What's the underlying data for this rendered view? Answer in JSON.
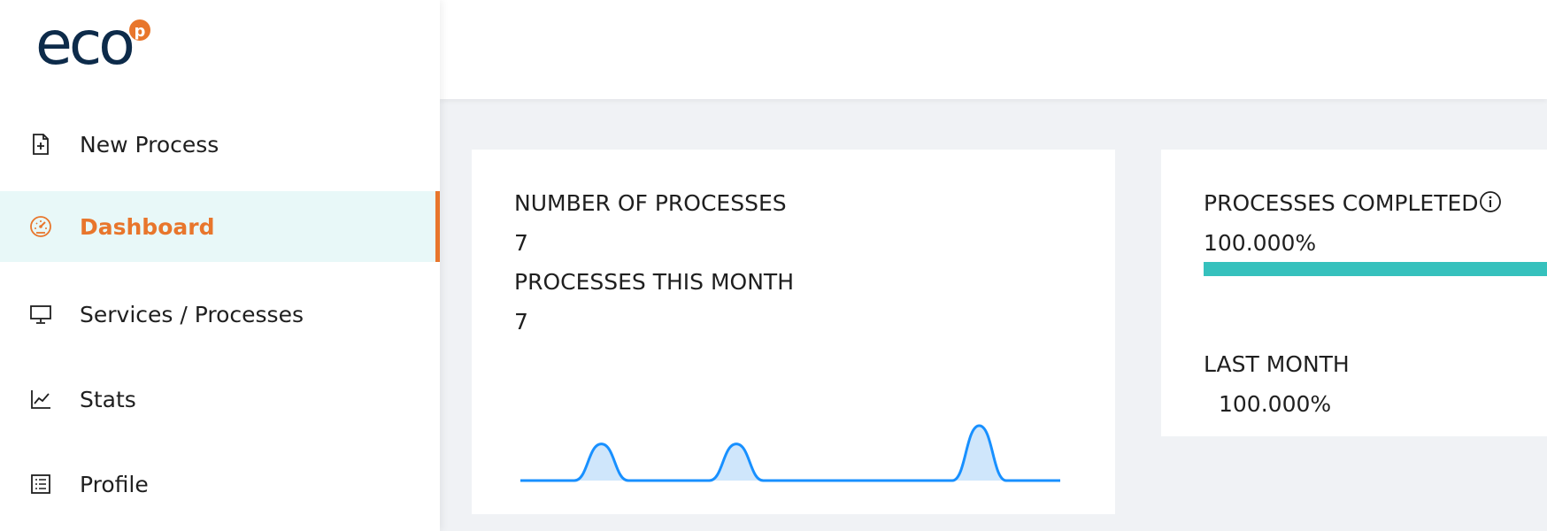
{
  "sidebar": {
    "logo_text": "eco",
    "logo_badge": "p",
    "items": [
      {
        "label": "New Process",
        "icon": "file-plus-icon",
        "active": false
      },
      {
        "label": "Dashboard",
        "icon": "speedometer-icon",
        "active": true
      },
      {
        "label": "Services / Processes",
        "icon": "monitor-icon",
        "active": false
      },
      {
        "label": "Stats",
        "icon": "line-chart-icon",
        "active": false
      },
      {
        "label": "Profile",
        "icon": "profile-list-icon",
        "active": false
      }
    ]
  },
  "colors": {
    "accent": "#e8762c",
    "active_bg": "#e8f8f8",
    "progress": "#36c1bd",
    "sparkline": "#1890ff",
    "logo_navy": "#0d2b4a"
  },
  "stats_card": {
    "number_label": "NUMBER OF PROCESSES",
    "number_value": "7",
    "month_label": "PROCESSES THIS MONTH",
    "month_value": "7"
  },
  "chart_data": {
    "type": "area",
    "x": [
      0,
      1,
      2,
      3,
      4,
      5,
      6,
      7,
      8,
      9,
      10,
      11,
      12,
      13,
      14,
      15,
      16,
      17,
      18,
      19,
      20
    ],
    "values": [
      0,
      0,
      0,
      1,
      0,
      0,
      0,
      0,
      1,
      0,
      0,
      0,
      0,
      0,
      0,
      0,
      0,
      1.5,
      0,
      0,
      0
    ],
    "title": "",
    "xlabel": "",
    "ylabel": ""
  },
  "completed_card": {
    "title": "PROCESSES COMPLETED",
    "value": "100.000%",
    "progress_fraction": 1.0,
    "last_month_label": "LAST MONTH",
    "last_month_value": "100.000%"
  }
}
